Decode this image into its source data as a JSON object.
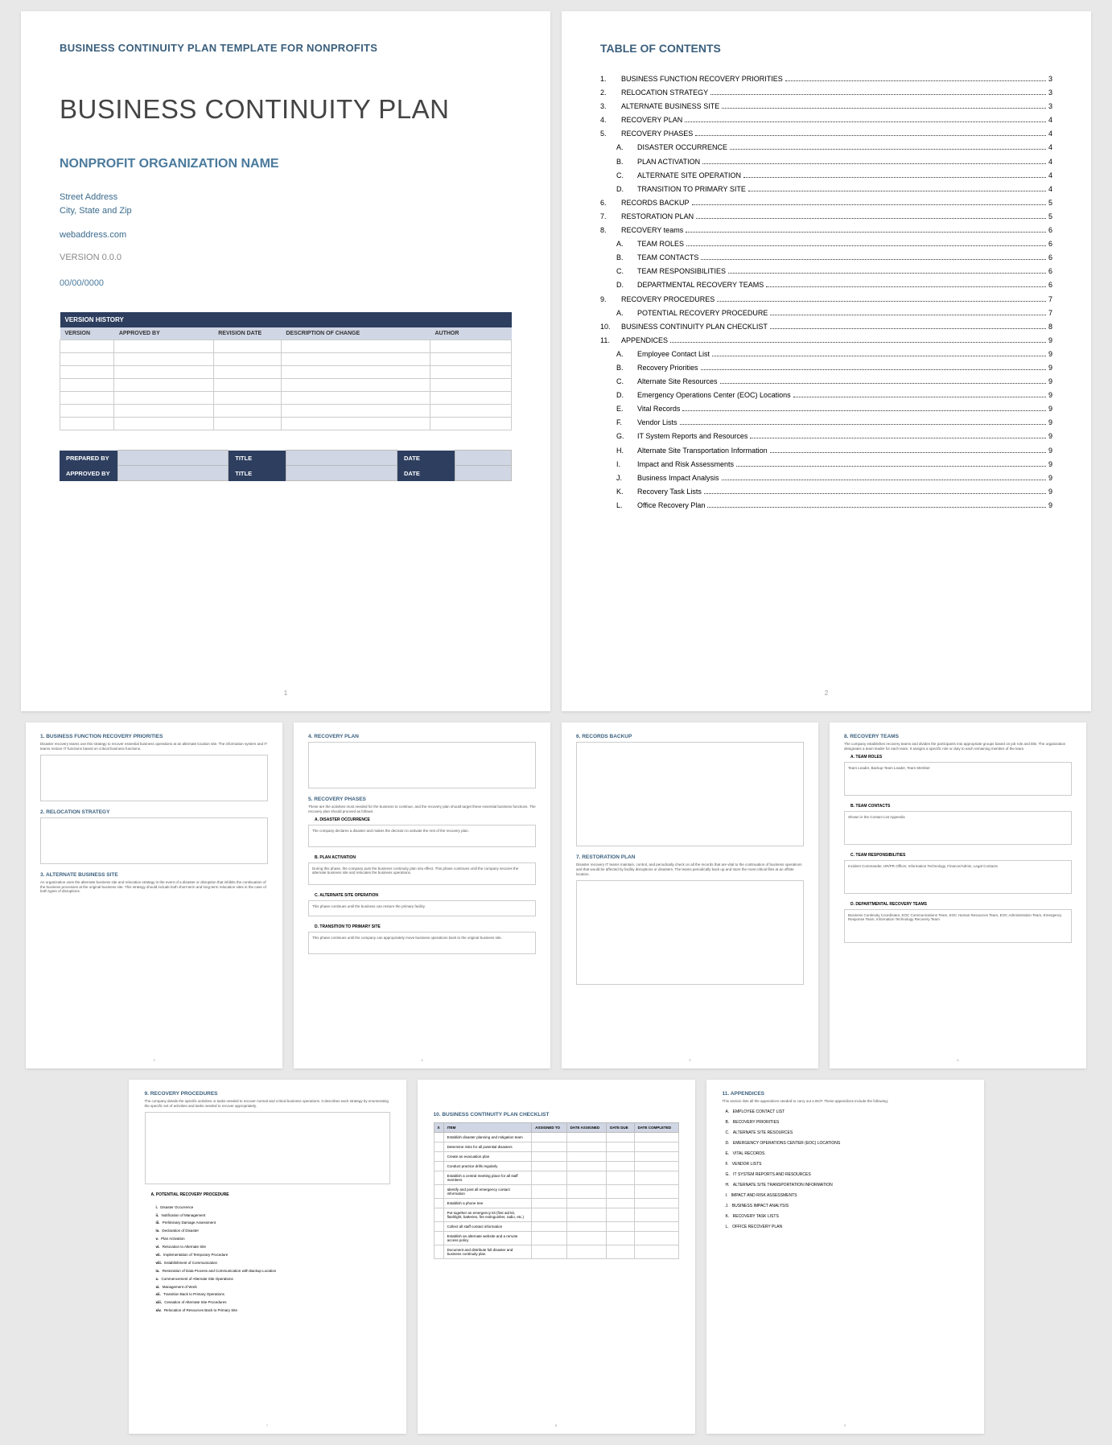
{
  "p1": {
    "header": "BUSINESS CONTINUITY PLAN TEMPLATE FOR NONPROFITS",
    "title": "BUSINESS CONTINUITY PLAN",
    "org": "NONPROFIT ORGANIZATION NAME",
    "addr1": "Street Address",
    "addr2": "City, State and Zip",
    "web": "webaddress.com",
    "version": "VERSION 0.0.0",
    "date": "00/00/0000",
    "vh_title": "VERSION HISTORY",
    "vh_cols": [
      "VERSION",
      "APPROVED BY",
      "REVISION DATE",
      "DESCRIPTION OF CHANGE",
      "AUTHOR"
    ],
    "sig": {
      "prepared": "PREPARED BY",
      "approved": "APPROVED BY",
      "title": "TITLE",
      "date": "DATE"
    },
    "pgnum": "1"
  },
  "p2": {
    "title": "TABLE OF CONTENTS",
    "pgnum": "2",
    "items": [
      {
        "n": "1.",
        "t": "BUSINESS FUNCTION RECOVERY PRIORITIES",
        "p": "3"
      },
      {
        "n": "2.",
        "t": "RELOCATION STRATEGY",
        "p": "3"
      },
      {
        "n": "3.",
        "t": "ALTERNATE BUSINESS SITE",
        "p": "3"
      },
      {
        "n": "4.",
        "t": "RECOVERY PLAN",
        "p": "4"
      },
      {
        "n": "5.",
        "t": "RECOVERY PHASES",
        "p": "4"
      },
      {
        "n": "A.",
        "t": "DISASTER OCCURRENCE",
        "p": "4",
        "s": 1
      },
      {
        "n": "B.",
        "t": "PLAN ACTIVATION",
        "p": "4",
        "s": 1
      },
      {
        "n": "C.",
        "t": "ALTERNATE SITE OPERATION",
        "p": "4",
        "s": 1
      },
      {
        "n": "D.",
        "t": "TRANSITION TO PRIMARY SITE",
        "p": "4",
        "s": 1
      },
      {
        "n": "6.",
        "t": "RECORDS BACKUP",
        "p": "5"
      },
      {
        "n": "7.",
        "t": "RESTORATION PLAN",
        "p": "5"
      },
      {
        "n": "8.",
        "t": "RECOVERY teams",
        "p": "6"
      },
      {
        "n": "A.",
        "t": "TEAM ROLES",
        "p": "6",
        "s": 1
      },
      {
        "n": "B.",
        "t": "TEAM CONTACTS",
        "p": "6",
        "s": 1
      },
      {
        "n": "C.",
        "t": "TEAM RESPONSIBILITIES",
        "p": "6",
        "s": 1
      },
      {
        "n": "D.",
        "t": "DEPARTMENTAL RECOVERY TEAMS",
        "p": "6",
        "s": 1
      },
      {
        "n": "9.",
        "t": "RECOVERY PROCEDURES",
        "p": "7"
      },
      {
        "n": "A.",
        "t": "POTENTIAL RECOVERY PROCEDURE",
        "p": "7",
        "s": 1
      },
      {
        "n": "10.",
        "t": "BUSINESS CONTINUITY PLAN CHECKLIST",
        "p": "8"
      },
      {
        "n": "11.",
        "t": "APPENDICES",
        "p": "9"
      },
      {
        "n": "A.",
        "t": "Employee Contact List",
        "p": "9",
        "s": 1
      },
      {
        "n": "B.",
        "t": "Recovery Priorities",
        "p": "9",
        "s": 1
      },
      {
        "n": "C.",
        "t": "Alternate Site Resources",
        "p": "9",
        "s": 1
      },
      {
        "n": "D.",
        "t": "Emergency Operations Center (EOC) Locations",
        "p": "9",
        "s": 1
      },
      {
        "n": "E.",
        "t": "Vital Records",
        "p": "9",
        "s": 1
      },
      {
        "n": "F.",
        "t": "Vendor Lists",
        "p": "9",
        "s": 1
      },
      {
        "n": "G.",
        "t": "IT System Reports and Resources",
        "p": "9",
        "s": 1
      },
      {
        "n": "H.",
        "t": "Alternate Site Transportation Information",
        "p": "9",
        "s": 1
      },
      {
        "n": "I.",
        "t": "Impact and Risk Assessments",
        "p": "9",
        "s": 1
      },
      {
        "n": "J.",
        "t": "Business Impact Analysis",
        "p": "9",
        "s": 1
      },
      {
        "n": "K.",
        "t": "Recovery Task Lists",
        "p": "9",
        "s": 1
      },
      {
        "n": "L.",
        "t": "Office Recovery Plan",
        "p": "9",
        "s": 1
      }
    ]
  },
  "p3": {
    "s1": {
      "h": "1. BUSINESS FUNCTION RECOVERY PRIORITIES",
      "d": "Disaster recovery teams use this strategy to recover essential business operations at an alternate location site. The information system and IT teams restore IT functions based on critical business functions."
    },
    "s2": {
      "h": "2. RELOCATION STRATEGY"
    },
    "s3": {
      "h": "3. ALTERNATE BUSINESS SITE",
      "d": "An organization uses the alternate business site and relocation strategy in the event of a disaster or disruption that inhibits the continuation of the business processes at the original business site. This strategy should include both short-term and long-term relocation sites in the case of both types of disruptions."
    },
    "pgnum": "3"
  },
  "p4": {
    "s4": {
      "h": "4. RECOVERY PLAN"
    },
    "s5": {
      "h": "5. RECOVERY PHASES",
      "d": "These are the activities most needed for the business to continue, and the recovery plan should target these essential business functions. The recovery plan should proceed as follows:"
    },
    "a": {
      "h": "A. DISASTER OCCURRENCE",
      "d": "The company declares a disaster and makes the decision to activate the rest of the recovery plan."
    },
    "b": {
      "h": "B. PLAN ACTIVATION",
      "d": "During this phase, the company puts the business continuity plan into effect. This phase continues until the company secures the alternate business site and relocates the business operations."
    },
    "c": {
      "h": "C. ALTERNATE SITE OPERATION",
      "d": "This phase continues until the business can restore the primary facility."
    },
    "dd": {
      "h": "D. TRANSITION TO PRIMARY SITE",
      "d": "This phase continues until the company can appropriately move business operations back to the original business site."
    },
    "pgnum": "4"
  },
  "p5": {
    "s6": {
      "h": "6. RECORDS BACKUP"
    },
    "s7": {
      "h": "7. RESTORATION PLAN",
      "d": "Disaster recovery IT teams maintain, control, and periodically check on all the records that are vital to the continuation of business operations and that would be affected by facility disruptions or disasters. The teams periodically back up and store the most critical files at an offsite location."
    },
    "pgnum": "5"
  },
  "p6": {
    "s8": {
      "h": "8. RECOVERY TEAMS",
      "d": "The company establishes recovery teams and divides the participants into appropriate groups based on job role and title. The organization designates a team leader for each team. It assigns a specific role or duty to each remaining member of the team."
    },
    "a": {
      "h": "A. TEAM ROLES",
      "d": "Team Leader, Backup Team Leader, Team Member"
    },
    "b": {
      "h": "B. TEAM CONTACTS",
      "d": "Shown in the Contact List Appendix"
    },
    "c": {
      "h": "C. TEAM RESPONSIBILITIES",
      "d": "Incident Commander, HR/PR Officer, Information Technology, Finance/Admin, Legal Contacts"
    },
    "dd": {
      "h": "D. DEPARTMENTAL RECOVERY TEAMS",
      "d": "Business Continuity Coordinator, EOC Communications Team, EOC Human Resources Team, EOC Administration Team, Emergency Response Team, Information Technology Recovery Team"
    },
    "pgnum": "6"
  },
  "p7": {
    "s9": {
      "h": "9. RECOVERY PROCEDURES",
      "d": "The company details the specific activities or tasks needed to recover normal and critical business operations. It describes each strategy by enumerating the specific set of activities and tasks needed to recover appropriately."
    },
    "a": {
      "h": "A. POTENTIAL RECOVERY PROCEDURE"
    },
    "steps": [
      {
        "r": "i",
        "t": "Disaster Occurrence"
      },
      {
        "r": "ii",
        "t": "Notification of Management"
      },
      {
        "r": "iii",
        "t": "Preliminary Damage Assessment"
      },
      {
        "r": "iv",
        "t": "Declaration of Disaster"
      },
      {
        "r": "v",
        "t": "Plan Activation"
      },
      {
        "r": "vi",
        "t": "Relocation to Alternate Site"
      },
      {
        "r": "vii",
        "t": "Implementation of Temporary Procedure"
      },
      {
        "r": "viii",
        "t": "Establishment of Communication"
      },
      {
        "r": "ix",
        "t": "Restoration of Data Process and Communication with Backup Location"
      },
      {
        "r": "x",
        "t": "Commencement of Alternate Site Operations"
      },
      {
        "r": "xi",
        "t": "Management of Work"
      },
      {
        "r": "xii",
        "t": "Transition Back to Primary Operations"
      },
      {
        "r": "xiii",
        "t": "Cessation of Alternate Site Procedures"
      },
      {
        "r": "xiv",
        "t": "Relocation of Resources Back to Primary Site"
      }
    ],
    "pgnum": "7"
  },
  "p8": {
    "h": "10. BUSINESS CONTINUITY PLAN CHECKLIST",
    "cols": [
      "X",
      "ITEM",
      "ASSIGNED TO",
      "DATE ASSIGNED",
      "DATE DUE",
      "DATE COMPLETED"
    ],
    "rows": [
      "Establish disaster planning and mitigation team",
      "Determine risks for all potential disasters",
      "Create an evacuation plan",
      "Conduct practice drills regularly",
      "Establish a central meeting place for all staff members",
      "Identify and post all emergency contact information",
      "Establish a phone tree",
      "Put together an emergency kit (first aid kit, flashlight, batteries, fire extinguisher, radio, etc.)",
      "Collect all staff contact information",
      "Establish an alternate website and a remote access policy",
      "Document and distribute full disaster and business continuity plan"
    ],
    "pgnum": "8"
  },
  "p9": {
    "h": "11. APPENDICES",
    "d": "This section lists all the appendices needed to carry out a BCP. These appendices include the following:",
    "items": [
      {
        "l": "A",
        "t": "EMPLOYEE CONTACT LIST"
      },
      {
        "l": "B",
        "t": "RECOVERY PRIORITIES"
      },
      {
        "l": "C",
        "t": "ALTERNATE SITE RESOURCES"
      },
      {
        "l": "D",
        "t": "EMERGENCY OPERATIONS CENTER (EOC) LOCATIONS"
      },
      {
        "l": "E",
        "t": "VITAL RECORDS"
      },
      {
        "l": "F",
        "t": "VENDOR LISTS"
      },
      {
        "l": "G",
        "t": "IT SYSTEM REPORTS AND RESOURCES"
      },
      {
        "l": "H",
        "t": "ALTERNATE SITE TRANSPORTATION INFORMATION"
      },
      {
        "l": "I",
        "t": "IMPACT AND RISK ASSESSMENTS"
      },
      {
        "l": "J",
        "t": "BUSINESS IMPACT ANALYSIS"
      },
      {
        "l": "K",
        "t": "RECOVERY TASK LISTS"
      },
      {
        "l": "L",
        "t": "OFFICE RECOVERY PLAN"
      }
    ],
    "pgnum": "9"
  }
}
